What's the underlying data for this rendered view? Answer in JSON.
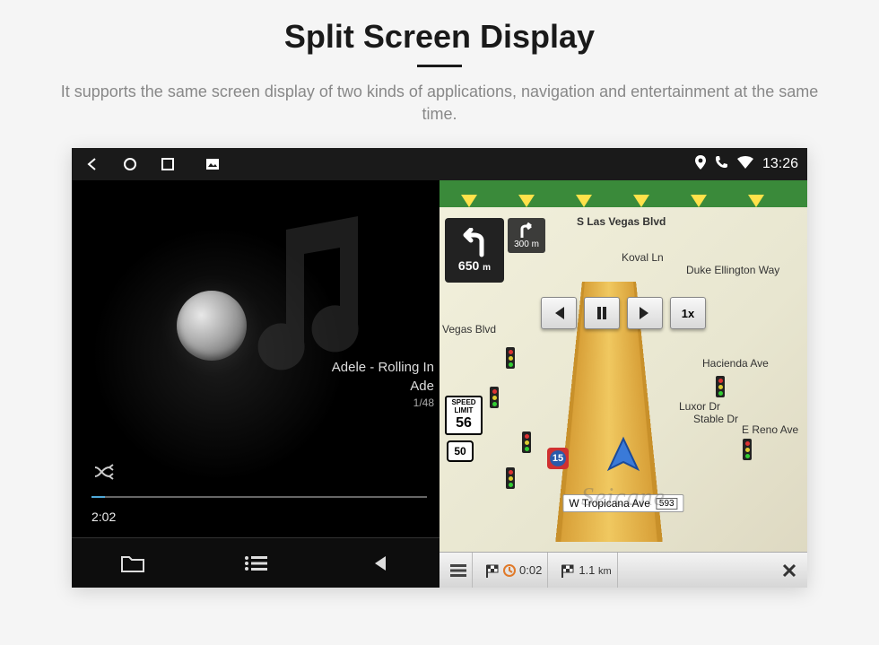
{
  "page": {
    "title": "Split Screen Display",
    "subtitle": "It supports the same screen display of two kinds of applications, navigation and entertainment at the same time."
  },
  "status": {
    "time": "13:26"
  },
  "music": {
    "track_title": "Adele - Rolling In",
    "track_artist": "Ade",
    "track_counter": "1/48",
    "elapsed": "2:02"
  },
  "nav": {
    "turn_distance": "650",
    "turn_unit": "m",
    "next_turn_distance": "300",
    "next_turn_unit": "m",
    "speed_limit_label": "SPEED LIMIT",
    "speed_limit_value": "56",
    "route_number": "50",
    "interstate_number": "15",
    "playback_speed": "1x",
    "eta_time": "0:02",
    "remaining_distance": "1.1",
    "remaining_unit": "km",
    "streets": {
      "top": "S Las Vegas Blvd",
      "koval": "Koval Ln",
      "duke": "Duke Ellington Way",
      "hacienda": "Hacienda Ave",
      "luxor": "Luxor Dr",
      "reno": "E Reno Ave",
      "stable": "Stable Dr",
      "vegas_top": "Vegas Blvd",
      "bottom": "W Tropicana Ave",
      "exit": "593"
    }
  },
  "watermark": "Seicane"
}
